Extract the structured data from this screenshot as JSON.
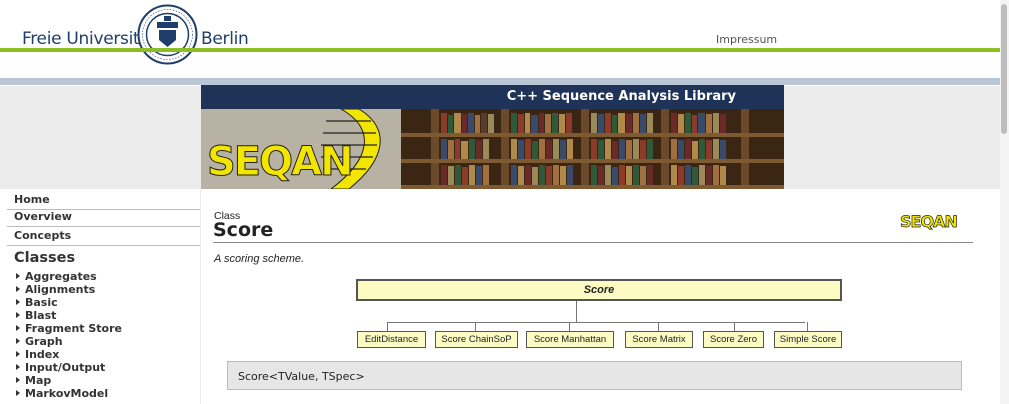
{
  "header": {
    "university_left": "Freie Universität",
    "university_right": "Berlin",
    "impressum": "Impressum",
    "colors": {
      "green": "#8cbf26",
      "blue_band": "#b8c6d6",
      "navy": "#1f3f6a"
    }
  },
  "banner": {
    "title": "C++ Sequence Analysis Library",
    "logo_text": "SEQAN",
    "colors": {
      "bar": "#1f3257",
      "logo": "#f2e600"
    }
  },
  "sidebar": {
    "top_items": [
      "Home",
      "Overview",
      "Concepts"
    ],
    "classes_heading": "Classes",
    "classes": [
      "Aggregates",
      "Alignments",
      "Basic",
      "Blast",
      "Fragment Store",
      "Graph",
      "Index",
      "Input/Output",
      "Map",
      "MarkovModel"
    ]
  },
  "main": {
    "kind": "Class",
    "name": "Score",
    "logo_text": "SEQAN",
    "description": "A scoring scheme.",
    "hierarchy": {
      "root": "Score",
      "children": [
        "EditDistance",
        "Score ChainSoP",
        "Score Manhattan",
        "Score Matrix",
        "Score Zero",
        "Simple Score"
      ]
    },
    "signature": "Score<TValue, TSpec>",
    "colors": {
      "box_fill": "#fbfbc3"
    }
  }
}
